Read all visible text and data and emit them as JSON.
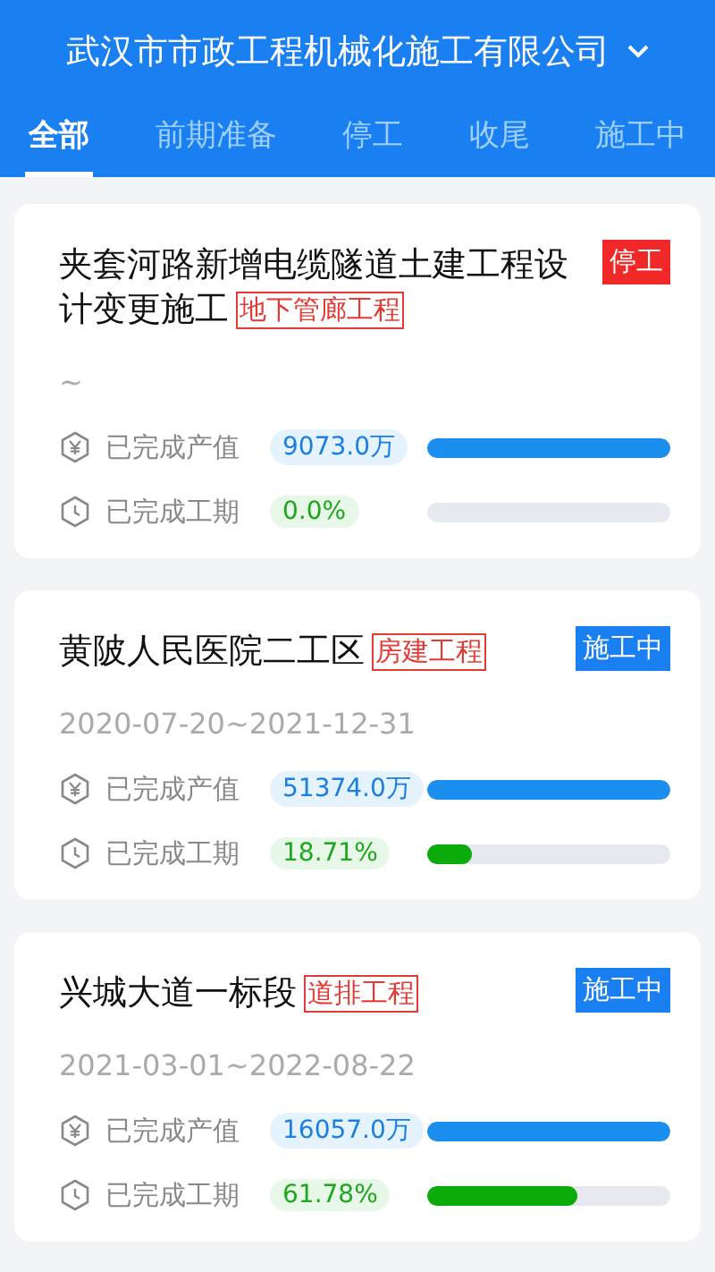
{
  "header": {
    "company": "武汉市市政工程机械化施工有限公司"
  },
  "tabs": [
    {
      "label": "全部",
      "selected": true
    },
    {
      "label": "前期准备",
      "selected": false
    },
    {
      "label": "停工",
      "selected": false
    },
    {
      "label": "收尾",
      "selected": false
    },
    {
      "label": "施工中",
      "selected": false
    }
  ],
  "projects": [
    {
      "title": "夹套河路新增电缆隧道土建工程设计变更施工",
      "category": "地下管廊工程",
      "status": {
        "label": "停工",
        "kind": "stopped"
      },
      "period": "~",
      "metrics": [
        {
          "kind": "output",
          "label": "已完成产值",
          "value": "9073.0万",
          "level": 1
        },
        {
          "kind": "schedule",
          "label": "已完成工期",
          "value": "0.0%",
          "level": 0
        }
      ]
    },
    {
      "title": "黄陂人民医院二工区",
      "category": "房建工程",
      "status": {
        "label": "施工中",
        "kind": "active"
      },
      "period": "2020-07-20~2021-12-31",
      "metrics": [
        {
          "kind": "output",
          "label": "已完成产值",
          "value": "51374.0万",
          "level": 1
        },
        {
          "kind": "schedule",
          "label": "已完成工期",
          "value": "18.71%",
          "level": 0.1871
        }
      ]
    },
    {
      "title": "兴城大道一标段",
      "category": "道排工程",
      "status": {
        "label": "施工中",
        "kind": "active"
      },
      "period": "2021-03-01~2022-08-22",
      "metrics": [
        {
          "kind": "output",
          "label": "已完成产值",
          "value": "16057.0万",
          "level": 1
        },
        {
          "kind": "schedule",
          "label": "已完成工期",
          "value": "61.78%",
          "level": 0.6178
        }
      ]
    }
  ]
}
